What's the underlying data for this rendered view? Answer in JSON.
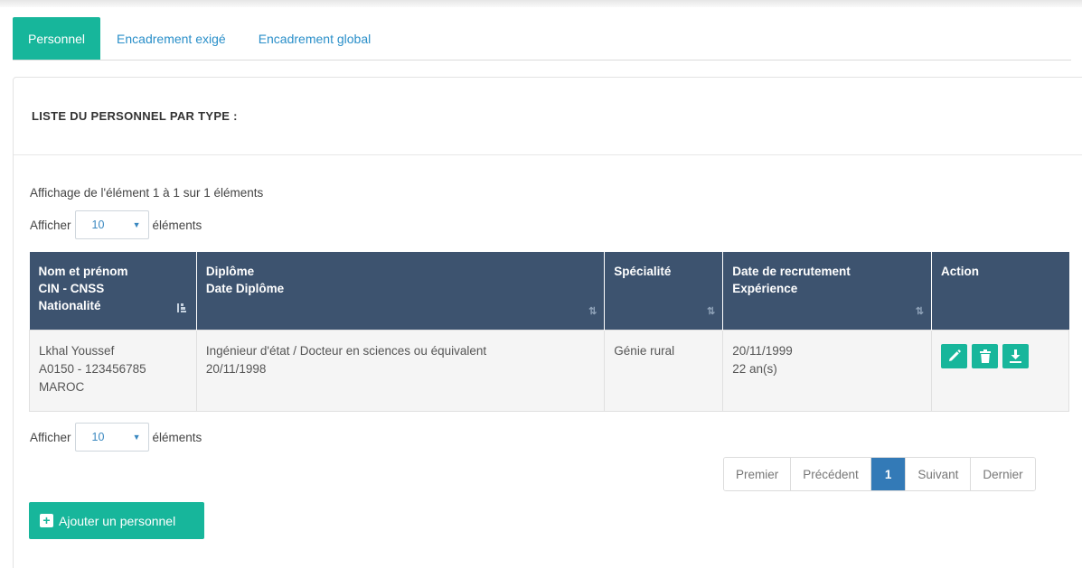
{
  "tabs": [
    {
      "label": "Personnel",
      "active": true
    },
    {
      "label": "Encadrement exigé",
      "active": false
    },
    {
      "label": "Encadrement global",
      "active": false
    }
  ],
  "panel": {
    "title": "LISTE DU PERSONNEL PAR TYPE :"
  },
  "table_info": "Affichage de l'élément 1 à 1 sur 1 éléments",
  "length_menu": {
    "prefix": "Afficher",
    "value": "10",
    "suffix": "éléments"
  },
  "columns": [
    {
      "line1": "Nom et prénom",
      "line2": "CIN - CNSS",
      "line3": "Nationalité",
      "sort": "sorted-asc"
    },
    {
      "line1": "Diplôme",
      "line2": "Date Diplôme",
      "line3": "",
      "sort": "sortable"
    },
    {
      "line1": "Spécialité",
      "line2": "",
      "line3": "",
      "sort": "sortable"
    },
    {
      "line1": "Date de recrutement",
      "line2": "Expérience",
      "line3": "",
      "sort": "sortable"
    },
    {
      "line1": "Action",
      "line2": "",
      "line3": "",
      "sort": "none"
    }
  ],
  "rows": [
    {
      "name": "Lkhal Youssef",
      "cin_cnss": "A0150 - 123456785",
      "nationality": "MAROC",
      "diploma": "Ingénieur d'état / Docteur en sciences ou équivalent",
      "diploma_date": "20/11/1998",
      "speciality": "Génie rural",
      "hire_date": "20/11/1999",
      "experience": "22 an(s)",
      "actions": [
        "edit-icon",
        "trash-icon",
        "download-icon"
      ]
    }
  ],
  "pagination": {
    "first": "Premier",
    "previous": "Précédent",
    "current": "1",
    "next": "Suivant",
    "last": "Dernier"
  },
  "add_button": {
    "label": "Ajouter un personnel",
    "icon": "plus-square-icon"
  },
  "colors": {
    "accent": "#17b69b",
    "table_header": "#3d536f",
    "link": "#2a8fc9",
    "pager_active": "#337ab7"
  }
}
